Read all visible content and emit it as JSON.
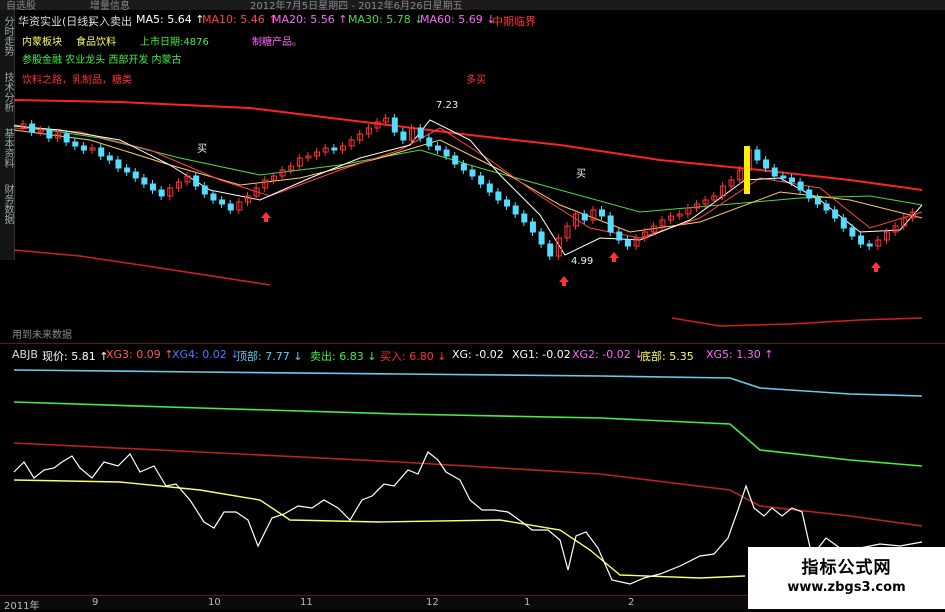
{
  "top_strip": {
    "left": "自选股",
    "mid": "增量信息",
    "dates": "2012年7月5日星期四 - 2012年6月26日星期五"
  },
  "side_tabs": [
    "分时走势",
    "技术分析",
    "基本资料",
    "财务数据"
  ],
  "header": {
    "title": "华资实业(日线)",
    "indicator": "买入卖出",
    "ma": [
      {
        "label": "MA5:",
        "value": "5.64",
        "arrow": "↑",
        "color": "#ffffff"
      },
      {
        "label": "MA10:",
        "value": "5.46",
        "arrow": "↑",
        "color": "#ff4444"
      },
      {
        "label": "MA20:",
        "value": "5.56",
        "arrow": "↑",
        "color": "#ff66ff"
      },
      {
        "label": "MA30:",
        "value": "5.78",
        "arrow": "↓",
        "color": "#44dd44"
      },
      {
        "label": "MA60:",
        "value": "5.69",
        "arrow": "↓",
        "color": "#ff66ff"
      }
    ],
    "extra": "中期临界"
  },
  "info_lines": {
    "sector": "内蒙板块",
    "food": "食品饮料",
    "listing": "上市日期:4876",
    "sugar": "制糖产品。",
    "concepts": "参股金融  农业龙头  西部开发  内蒙古",
    "products": "饮料之路，乳制品，糖类",
    "buy_hint": "多买"
  },
  "annotations": {
    "high_price": "7.23",
    "low_price": "4.99",
    "buy1": "买",
    "buy2": "买",
    "future_data": "用到未来数据"
  },
  "sub_header": {
    "name": "ABJB",
    "items": [
      {
        "label": "现价:",
        "value": "5.81",
        "arrow": "↑",
        "color": "#ffffff"
      },
      {
        "label": "XG3:",
        "value": "0.09",
        "arrow": "↑",
        "color": "#ff5555"
      },
      {
        "label": "XG4:",
        "value": "0.02",
        "arrow": "↓",
        "color": "#5577ff"
      },
      {
        "label": "顶部:",
        "value": "7.77",
        "arrow": "↓",
        "color": "#66ccee"
      },
      {
        "label": "卖出:",
        "value": "6.83",
        "arrow": "↓",
        "color": "#44ee44"
      },
      {
        "label": "买入:",
        "value": "6.80",
        "arrow": "↓",
        "color": "#ff3333"
      },
      {
        "label": "XG:",
        "value": "-0.02",
        "arrow": "",
        "color": "#ffffff"
      },
      {
        "label": "XG1:",
        "value": "-0.02",
        "arrow": "",
        "color": "#ffffff"
      },
      {
        "label": "XG2:",
        "value": "-0.02",
        "arrow": "↓",
        "color": "#ff66ff"
      },
      {
        "label": "底部:",
        "value": "5.35",
        "arrow": "",
        "color": "#ffff66"
      },
      {
        "label": "XG5:",
        "value": "1.30",
        "arrow": "↑",
        "color": "#ff66ff"
      }
    ]
  },
  "x_axis": {
    "labels": [
      "2011年",
      "9",
      "10",
      "11",
      "12",
      "1",
      "2"
    ]
  },
  "watermark": {
    "line1": "指标公式网",
    "line2": "www.zbgs3.com"
  },
  "colors": {
    "ma5": "#ffffff",
    "ma10": "#ff4444",
    "ma20": "#ff66ff",
    "ma30": "#44dd44",
    "ma60": "#ff66ff",
    "top": "#66ccee",
    "sell": "#44ee44",
    "buy": "#ff3333",
    "bottom": "#ffff66"
  }
}
